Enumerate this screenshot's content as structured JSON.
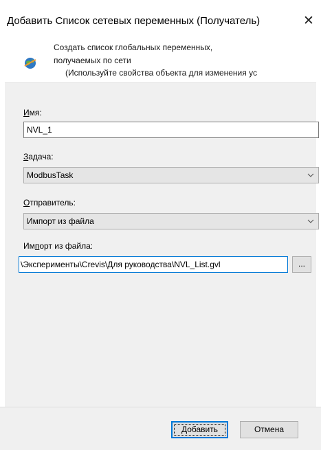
{
  "dialog": {
    "title": "Добавить Список сетевых переменных (Получатель)",
    "close_glyph": "✕"
  },
  "header": {
    "line1": "Создать список глобальных переменных,",
    "line2": "получаемых по сети",
    "line3": "(Используйте свойства объекта для изменения ус"
  },
  "form": {
    "name_label_access": "И",
    "name_label_rest": "мя:",
    "name_value": "NVL_1",
    "task_label_access": "З",
    "task_label_rest": "адача:",
    "task_value": "ModbusTask",
    "sender_label_access": "О",
    "sender_label_rest": "тправитель:",
    "sender_value": "Импорт из файла",
    "import_label_pre": "Им",
    "import_label_access": "п",
    "import_label_rest": "орт из файла:",
    "import_path": "\\Эксперименты\\Crevis\\Для руководства\\NVL_List.gvl",
    "browse_label": "..."
  },
  "buttons": {
    "add_label": "Добавить",
    "cancel_label": "Отмена"
  },
  "colors": {
    "accent": "#0078d7",
    "content_bg": "#f0f0f0",
    "combo_bg": "#e5e5e5"
  }
}
